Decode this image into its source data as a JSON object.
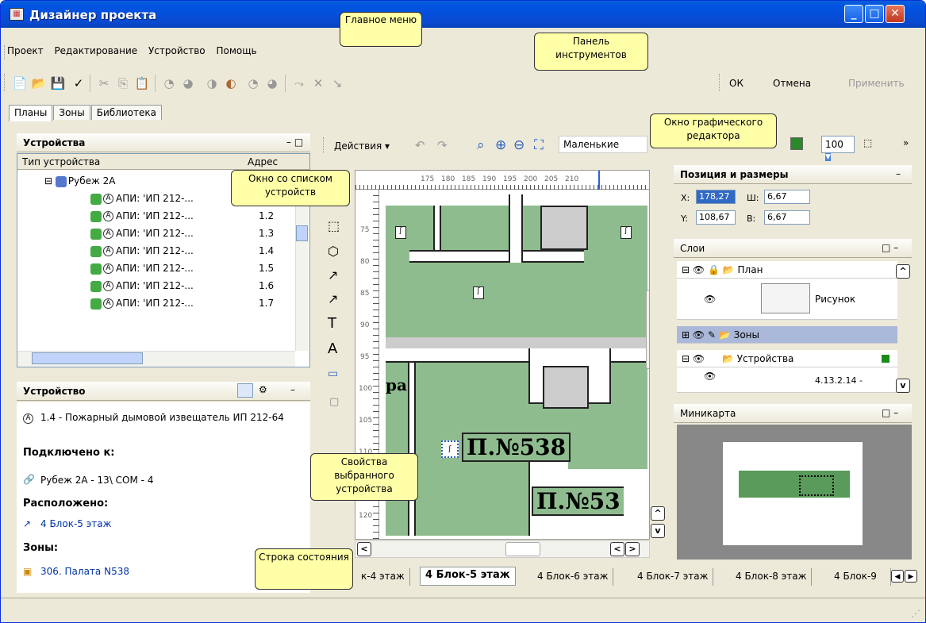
{
  "window": {
    "title": "Дизайнер проекта"
  },
  "menu": {
    "items": [
      "Проект",
      "Редактирование",
      "Устройство",
      "Помощь"
    ]
  },
  "toolbar": {
    "ok": "ОК",
    "cancel": "Отмена",
    "apply": "Применить"
  },
  "tabs": [
    "Планы",
    "Зоны",
    "Библиотека"
  ],
  "devices_panel": {
    "title": "Устройства",
    "col_type": "Тип устройства",
    "col_addr": "Адрес",
    "root": "Рубеж 2А",
    "rows": [
      {
        "name": "АПИ: 'ИП 212-...",
        "addr": ""
      },
      {
        "name": "АПИ: 'ИП 212-...",
        "addr": "1.2"
      },
      {
        "name": "АПИ: 'ИП 212-...",
        "addr": "1.3"
      },
      {
        "name": "АПИ: 'ИП 212-...",
        "addr": "1.4"
      },
      {
        "name": "АПИ: 'ИП 212-...",
        "addr": "1.5"
      },
      {
        "name": "АПИ: 'ИП 212-...",
        "addr": "1.6"
      },
      {
        "name": "АПИ: 'ИП 212-...",
        "addr": "1.7"
      }
    ]
  },
  "device_panel": {
    "title": "Устройство",
    "device": "1.4 - Пожарный дымовой извещатель ИП 212-64",
    "connected_label": "Подключено к:",
    "connected": "Рубеж 2А - 13\\ COM - 4",
    "located_label": "Расположено:",
    "located": "4 Блок-5 этаж",
    "zones_label": "Зоны:",
    "zone": "306. Палата N538"
  },
  "editor": {
    "actions": "Действия",
    "size_select": "Маленькие",
    "zoom": "100",
    "room1": "П.№538",
    "room2": "П.№53",
    "room3": "ра",
    "ruler_x": [
      "175",
      "180",
      "185",
      "190",
      "195",
      "200",
      "205",
      "210"
    ],
    "ruler_y": [
      "75",
      "80",
      "85",
      "90",
      "95",
      "100",
      "105",
      "110",
      "115",
      "120",
      "125"
    ]
  },
  "position_panel": {
    "title": "Позиция и размеры",
    "x_label": "X:",
    "x": "178,27",
    "w_label": "Ш:",
    "w": "6,67",
    "y_label": "Y:",
    "y": "108,67",
    "h_label": "В:",
    "h": "6,67"
  },
  "layers_panel": {
    "title": "Слои",
    "rows": [
      "План",
      "Рисунок",
      "Зоны",
      "Устройства",
      "4.13.2.14 -"
    ]
  },
  "minimap_panel": {
    "title": "Миникарта"
  },
  "floor_tabs": [
    "к-4 этаж",
    "4 Блок-5 этаж",
    "4 Блок-6 этаж",
    "4 Блок-7 этаж",
    "4 Блок-8 этаж",
    "4 Блок-9"
  ],
  "callouts": {
    "main_menu": "Главное меню",
    "toolbar": "Панель инструментов",
    "device_list": "Окно со списком устройств",
    "graphic_editor": "Окно графического редактора",
    "device_props": "Свойства выбранного устройства",
    "status_bar": "Строка состояния"
  }
}
